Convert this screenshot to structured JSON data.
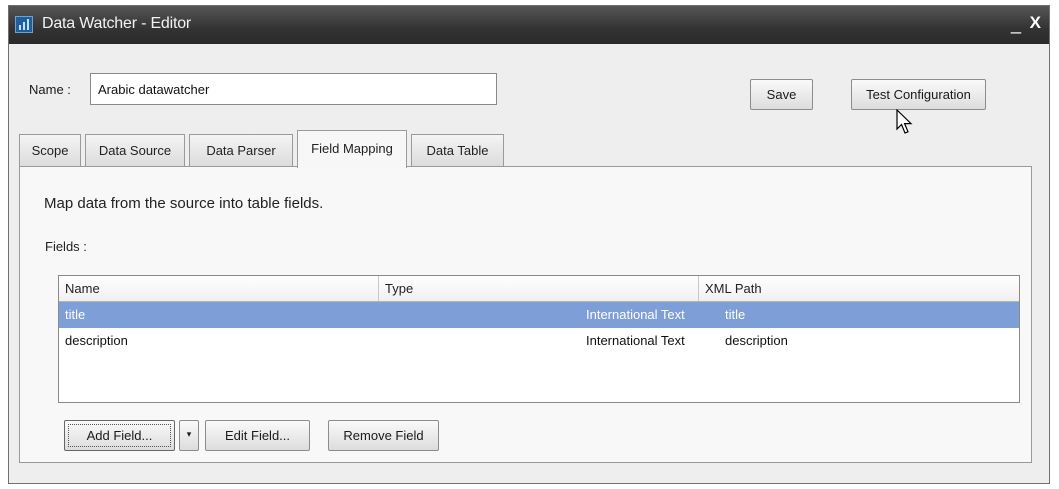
{
  "window": {
    "title": "Data Watcher - Editor",
    "minimize_label": "_",
    "close_label": "X"
  },
  "name_field": {
    "label": "Name :",
    "value": "Arabic datawatcher"
  },
  "toolbar": {
    "save_label": "Save",
    "test_label": "Test Configuration"
  },
  "tabs": [
    {
      "label": "Scope",
      "active": false
    },
    {
      "label": "Data Source",
      "active": false
    },
    {
      "label": "Data Parser",
      "active": false
    },
    {
      "label": "Field Mapping",
      "active": true
    },
    {
      "label": "Data Table",
      "active": false
    }
  ],
  "panel": {
    "instruction": "Map data from the source into table fields.",
    "fields_label": "Fields :"
  },
  "table": {
    "columns": [
      "Name",
      "Type",
      "XML Path"
    ],
    "rows": [
      {
        "name": "title",
        "type": "International Text",
        "xml_path": "title",
        "selected": true
      },
      {
        "name": "description",
        "type": "International Text",
        "xml_path": "description",
        "selected": false
      }
    ]
  },
  "buttons": {
    "add": "Add Field...",
    "dropdown": "▾",
    "edit": "Edit Field...",
    "remove": "Remove Field"
  },
  "colors": {
    "selection": "#7d9ed6",
    "titlebar": "#333333"
  }
}
